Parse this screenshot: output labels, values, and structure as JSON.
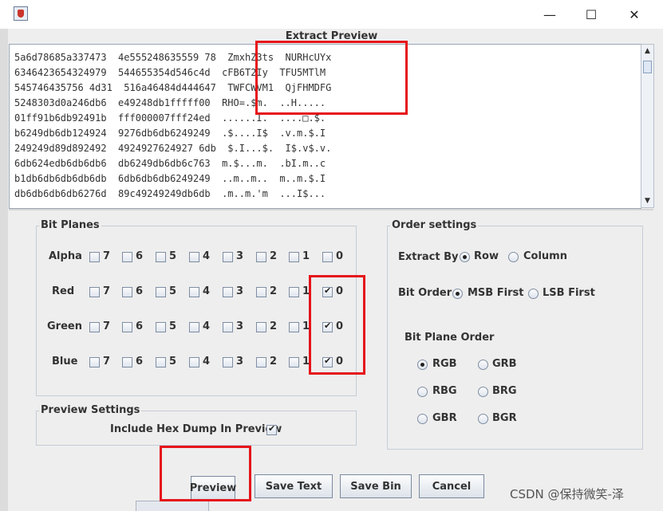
{
  "window": {
    "minimize": "—",
    "maximize": "☐",
    "close": "✕"
  },
  "preview": {
    "title": "Extract Preview",
    "lines": [
      "5a6d78685a337473  4e555248635559 78  ZmxhZ3ts  NURHcUYx",
      "6346423654324979  544655354d546c4d  cFB6T2Iy  TFU5MTlM",
      "545746435756 4d31  516a46484d444647  TWFCWVM1  QjFHMDFG",
      "5248303d0a246db6  e49248db1fffff00  RHO=.$m.  ..H.....",
      "01ff91b6db92491b  fff000007fff24ed  ......I.  ....□.$.",
      "b6249db6db124924  9276db6db6249249  .$....I$  .v.m.$.I",
      "249249d89d892492  4924927624927 6db  $.I...$.  I$.v$.v.",
      "6db624edb6db6db6  db6249db6db6c763  m.$...m.  .bI.m..c",
      "b1db6db6db6db6db  6db6db6db6249249  ..m..m..  m..m.$.I",
      "db6db6db6db6276d  89c49249249db6db  .m..m.'m  ...I$..."
    ]
  },
  "bit_planes": {
    "title": "Bit Planes",
    "rows": [
      {
        "label": "Alpha",
        "bits": [
          "7",
          "6",
          "5",
          "4",
          "3",
          "2",
          "1",
          "0"
        ],
        "checked": []
      },
      {
        "label": "Red",
        "bits": [
          "7",
          "6",
          "5",
          "4",
          "3",
          "2",
          "1",
          "0"
        ],
        "checked": [
          "0"
        ]
      },
      {
        "label": "Green",
        "bits": [
          "7",
          "6",
          "5",
          "4",
          "3",
          "2",
          "1",
          "0"
        ],
        "checked": [
          "0"
        ]
      },
      {
        "label": "Blue",
        "bits": [
          "7",
          "6",
          "5",
          "4",
          "3",
          "2",
          "1",
          "0"
        ],
        "checked": [
          "0"
        ]
      }
    ]
  },
  "preview_settings": {
    "title": "Preview Settings",
    "hex_dump_label": "Include Hex Dump In Preview",
    "hex_dump_checked": true
  },
  "order_settings": {
    "title": "Order settings",
    "extract_by_label": "Extract By",
    "extract_options": [
      "Row",
      "Column"
    ],
    "extract_selected": "Row",
    "bit_order_label": "Bit Order",
    "bit_order_options": [
      "MSB First",
      "LSB First"
    ],
    "bit_order_selected": "MSB First",
    "plane_order_label": "Bit Plane Order",
    "plane_order_options": [
      "RGB",
      "GRB",
      "RBG",
      "BRG",
      "GBR",
      "BGR"
    ],
    "plane_order_selected": "RGB"
  },
  "buttons": {
    "preview": "Preview",
    "save_text": "Save Text",
    "save_bin": "Save Bin",
    "cancel": "Cancel"
  },
  "watermark": "CSDN @保持微笑-泽"
}
